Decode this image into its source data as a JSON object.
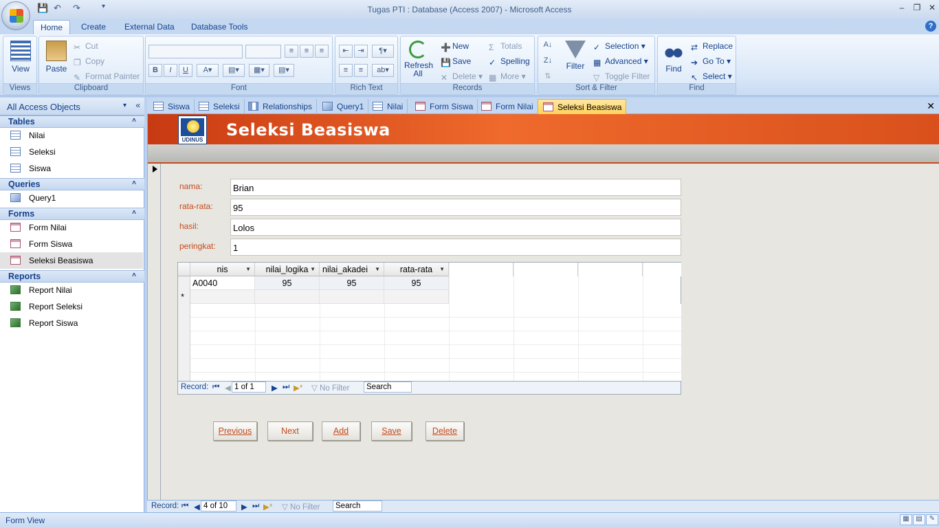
{
  "window": {
    "title": "Tugas PTI : Database (Access 2007) - Microsoft Access"
  },
  "ribbon_tabs": [
    "Home",
    "Create",
    "External Data",
    "Database Tools"
  ],
  "ribbon": {
    "views": {
      "view": "View",
      "label": "Views"
    },
    "clipboard": {
      "paste": "Paste",
      "cut": "Cut",
      "copy": "Copy",
      "format_painter": "Format Painter",
      "label": "Clipboard"
    },
    "font": {
      "label": "Font"
    },
    "rich_text": {
      "label": "Rich Text"
    },
    "records": {
      "refresh": "Refresh All",
      "new": "New",
      "save": "Save",
      "delete": "Delete",
      "totals": "Totals",
      "spelling": "Spelling",
      "more": "More",
      "label": "Records"
    },
    "sort_filter": {
      "filter": "Filter",
      "selection": "Selection",
      "advanced": "Advanced",
      "toggle_filter": "Toggle Filter",
      "label": "Sort & Filter"
    },
    "find": {
      "find": "Find",
      "replace": "Replace",
      "goto": "Go To",
      "select": "Select",
      "label": "Find"
    }
  },
  "nav": {
    "header": "All Access Objects",
    "sections": [
      {
        "title": "Tables",
        "items": [
          "Nilai",
          "Seleksi",
          "Siswa"
        ]
      },
      {
        "title": "Queries",
        "items": [
          "Query1"
        ]
      },
      {
        "title": "Forms",
        "items": [
          "Form Nilai",
          "Form Siswa",
          "Seleksi Beasiswa"
        ]
      },
      {
        "title": "Reports",
        "items": [
          "Report Nilai",
          "Report Seleksi",
          "Report Siswa"
        ]
      }
    ]
  },
  "doc_tabs": [
    "Siswa",
    "Seleksi",
    "Relationships",
    "Query1",
    "Nilai",
    "Form Siswa",
    "Form Nilai",
    "Seleksi Beasiswa"
  ],
  "form": {
    "title": "Seleksi Beasiswa",
    "logo_text": "UDINUS",
    "fields": [
      {
        "label": "nama:",
        "value": "Brian"
      },
      {
        "label": "rata-rata:",
        "value": "95"
      },
      {
        "label": "hasil:",
        "value": "Lolos"
      },
      {
        "label": "peringkat:",
        "value": "1"
      }
    ],
    "subform": {
      "columns": [
        "nis",
        "nilai_logika",
        "nilai_akadei",
        "rata-rata"
      ],
      "rows": [
        [
          "A0040",
          "95",
          "95",
          "95"
        ]
      ],
      "new_row_marker": "*",
      "nav": {
        "label": "Record:",
        "position": "1 of 1",
        "filter": "No Filter",
        "search": "Search"
      }
    },
    "buttons": [
      "Previous",
      "Next",
      "Add",
      "Save",
      "Delete"
    ]
  },
  "record_nav": {
    "label": "Record:",
    "position": "4 of 10",
    "filter": "No Filter",
    "search": "Search"
  },
  "status": {
    "text": "Form View"
  }
}
